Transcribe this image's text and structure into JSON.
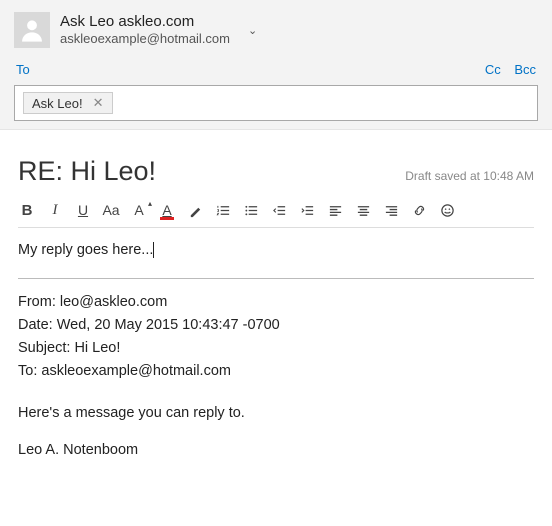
{
  "sender": {
    "name": "Ask Leo askleo.com",
    "email": "askleoexample@hotmail.com"
  },
  "recipients": {
    "to_label": "To",
    "cc_label": "Cc",
    "bcc_label": "Bcc",
    "chip_name": "Ask Leo!"
  },
  "subject": "RE: Hi Leo!",
  "draft_status": "Draft saved at 10:48 AM",
  "compose_text": "My reply goes here...",
  "quoted": {
    "from_label": "From:",
    "from_value": "leo@askleo.com",
    "date_label": "Date:",
    "date_value": "Wed, 20 May 2015 10:43:47 -0700",
    "subject_label": "Subject:",
    "subject_value": "Hi Leo!",
    "to_label": "To:",
    "to_value": "askleoexample@hotmail.com",
    "body": "Here's a message you can reply to.",
    "signature": "Leo A. Notenboom"
  },
  "toolbar": {
    "bold": "B",
    "italic": "I",
    "underline": "U",
    "font_size": "Aa",
    "font_size_sup": "A",
    "font_color": "A"
  }
}
